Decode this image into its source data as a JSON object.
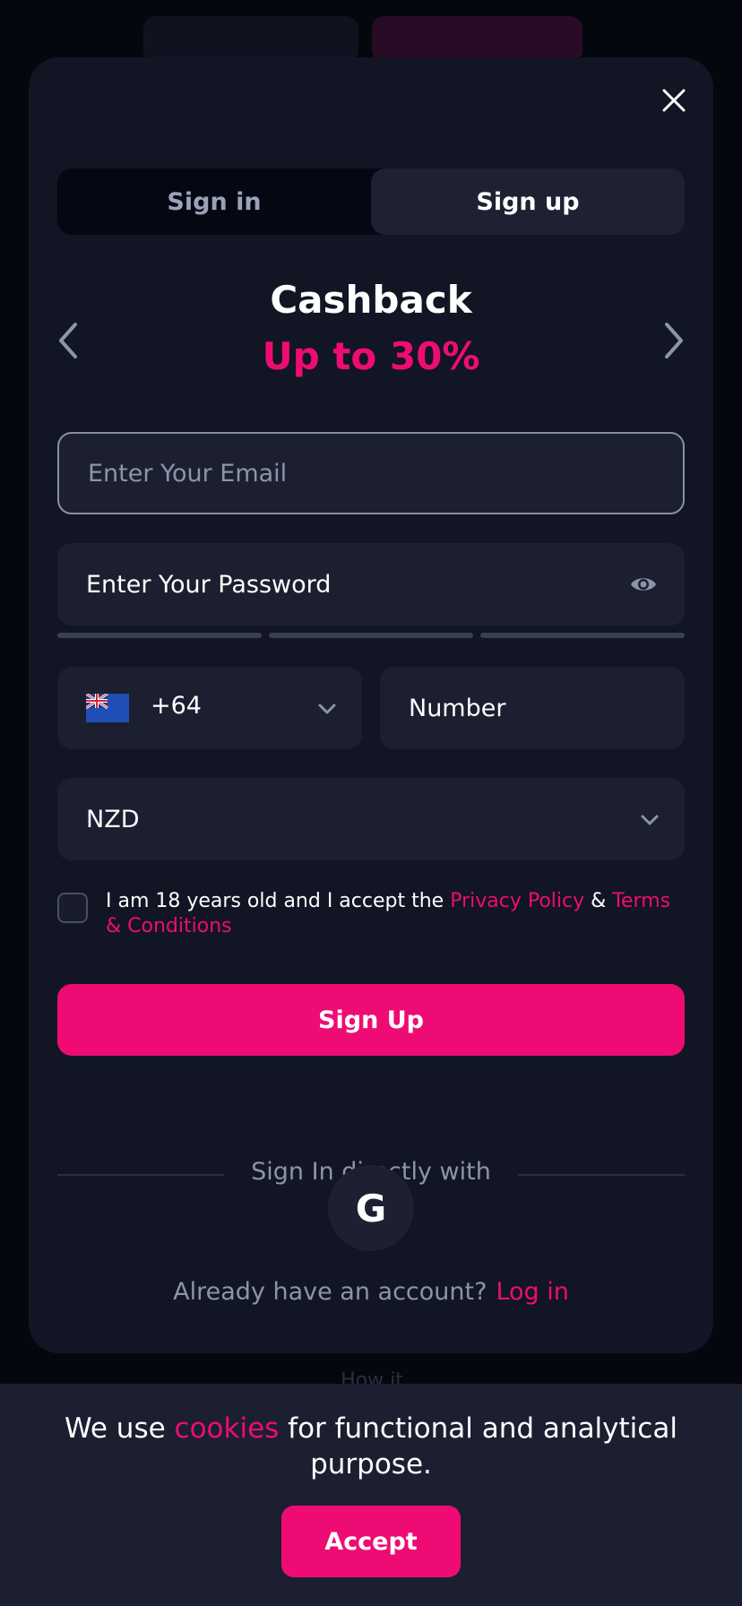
{
  "colors": {
    "accent": "#ee0c74",
    "modal_bg": "#121523",
    "field_bg": "#1b1f2f",
    "muted_text": "#8d94a8"
  },
  "tabs": [
    {
      "label": "Sign in",
      "active": false
    },
    {
      "label": "Sign up",
      "active": true
    }
  ],
  "promo": {
    "title": "Cashback",
    "subtitle": "Up to 30%"
  },
  "form": {
    "email_placeholder": "Enter Your Email",
    "password_placeholder": "Enter Your Password",
    "phone_code": "+64",
    "phone_flag": "new-zealand-flag-icon",
    "number_placeholder": "Number",
    "currency": "NZD",
    "consent_prefix": "I am 18 years old and I accept the ",
    "privacy_link": "Privacy Policy",
    "consent_joiner": " & ",
    "terms_link": "Terms & Conditions",
    "submit_label": "Sign Up"
  },
  "social": {
    "divider_label": "Sign In directly with",
    "google_letter": "G"
  },
  "footer": {
    "already_text": "Already have an account?",
    "login_link": "Log in"
  },
  "cookie": {
    "prefix": "We use ",
    "link": "cookies",
    "suffix": " for functional and analytical purpose.",
    "accept_label": "Accept"
  },
  "background": {
    "peek_text": "How it"
  }
}
